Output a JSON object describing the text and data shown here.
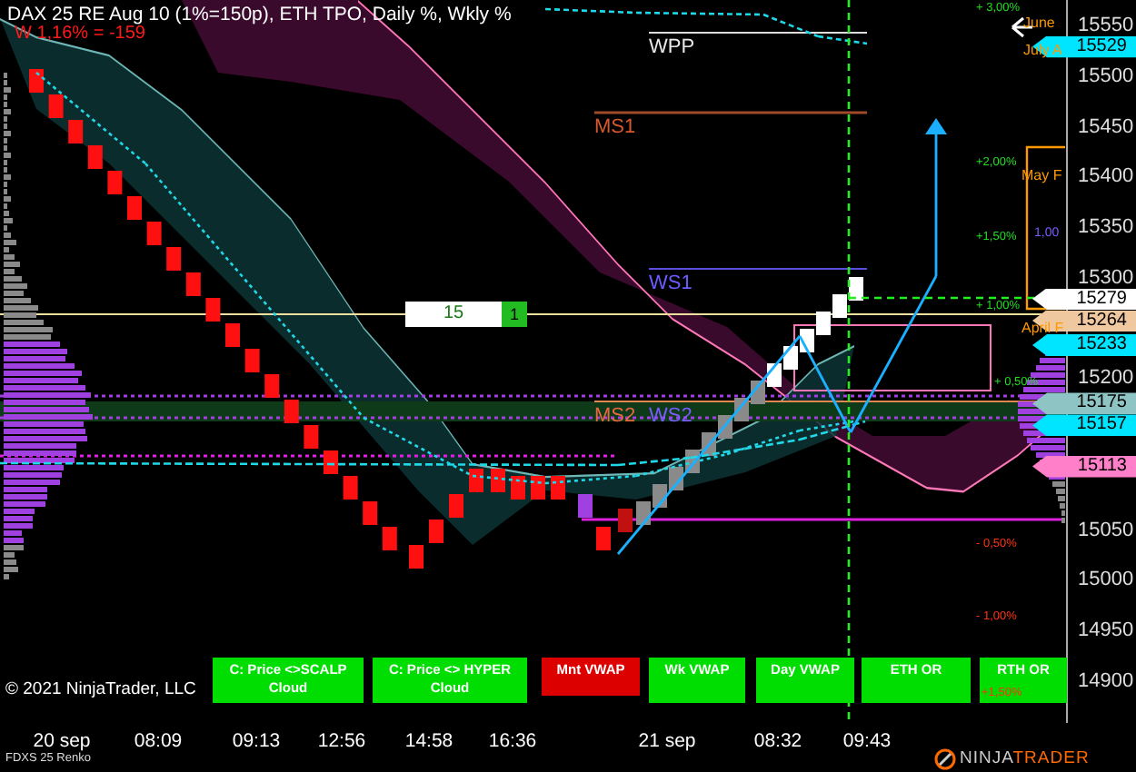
{
  "title": "DAX 25 RE Aug 10 (1%=150p), ETH TPO, Daily %, Wkly %",
  "subtitle": "W 1,16% = -159",
  "price_axis": [
    "15550",
    "15500",
    "15450",
    "15400",
    "15350",
    "15300",
    "15200",
    "15050",
    "15000",
    "14950",
    "14900"
  ],
  "price_markers": [
    {
      "label": "15529",
      "color": "#00e5ff"
    },
    {
      "label": "15279",
      "color": "#ffffff"
    },
    {
      "label": "15264",
      "color": "#f0c8a0"
    },
    {
      "label": "15233",
      "color": "#00e5ff"
    },
    {
      "label": "15175",
      "color": "#8fc4c4"
    },
    {
      "label": "15157",
      "color": "#00e5ff"
    },
    {
      "label": "15113",
      "color": "#ff7fc8"
    }
  ],
  "pivot_levels": [
    {
      "label": "WPP",
      "color": "#e8e8e8"
    },
    {
      "label": "MS1",
      "color": "#d8582e"
    },
    {
      "label": "WS1",
      "color": "#6a5cff"
    },
    {
      "label": "MS2",
      "color": "#e8683e"
    },
    {
      "label": "WS2",
      "color": "#7b5cff"
    }
  ],
  "percent_labels": [
    {
      "label": "+ 3,00%",
      "kind": "up"
    },
    {
      "label": "+2,00%",
      "kind": "up"
    },
    {
      "label": "+1,50%",
      "kind": "up"
    },
    {
      "label": "+ 1,00%",
      "kind": "up"
    },
    {
      "label": "+ 0,50%",
      "kind": "up"
    },
    {
      "label": "- 0,50%",
      "kind": "down"
    },
    {
      "label": "- 1,00%",
      "kind": "down"
    }
  ],
  "period_labels": [
    "June",
    "July A",
    "May F",
    "1,00",
    "April F"
  ],
  "counter_box": {
    "value": "15",
    "count": "1"
  },
  "buttons": [
    {
      "label": "C: Price <>SCALP Cloud",
      "active": true
    },
    {
      "label": "C: Price <> HYPER Cloud",
      "active": true
    },
    {
      "label": "Mnt VWAP",
      "active": false
    },
    {
      "label": "Wk VWAP",
      "active": true
    },
    {
      "label": "Day VWAP",
      "active": true
    },
    {
      "label": "ETH OR",
      "active": true
    },
    {
      "label": "RTH OR",
      "active": true
    }
  ],
  "button_note": "+1,50%",
  "copyright": "© 2021 NinjaTrader, LLC",
  "time_axis": [
    "20 sep",
    "08:09",
    "09:13",
    "12:56",
    "14:58",
    "16:36",
    "21 sep",
    "08:32",
    "09:43"
  ],
  "instrument": "FDXS 25 Renko",
  "logo": {
    "part_1": "NINJA",
    "part_2": "TRADER"
  }
}
